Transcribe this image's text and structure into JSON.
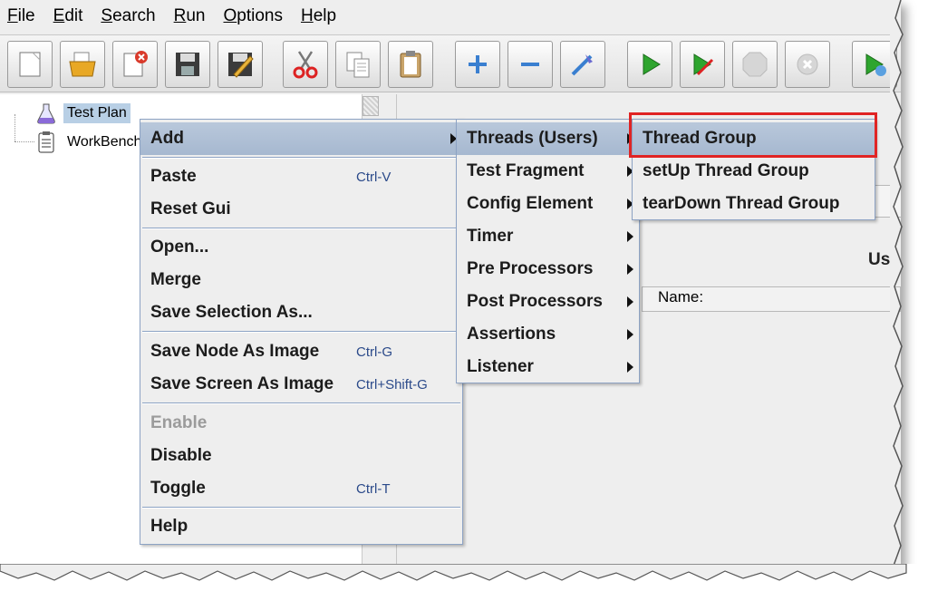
{
  "menubar": [
    "File",
    "Edit",
    "Search",
    "Run",
    "Options",
    "Help"
  ],
  "toolbar": {
    "buttons": [
      {
        "name": "new-icon"
      },
      {
        "name": "open-icon"
      },
      {
        "name": "close-file-icon"
      },
      {
        "name": "save-icon"
      },
      {
        "name": "save-as-icon"
      },
      {
        "name": "cut-icon"
      },
      {
        "name": "copy-icon"
      },
      {
        "name": "paste-icon"
      },
      {
        "name": "expand-icon"
      },
      {
        "name": "collapse-icon"
      },
      {
        "name": "toggle-icon"
      },
      {
        "name": "start-icon"
      },
      {
        "name": "start-no-pauses-icon"
      },
      {
        "name": "stop-icon"
      },
      {
        "name": "shutdown-icon"
      },
      {
        "name": "remote-start-icon"
      }
    ]
  },
  "tree": {
    "nodes": [
      {
        "label": "Test Plan",
        "selected": true
      },
      {
        "label": "WorkBench",
        "selected": false
      }
    ]
  },
  "right_panel": {
    "name_label": "Name:",
    "partial_label": "Us"
  },
  "context_menu": {
    "items": [
      {
        "label": "Add",
        "shortcut": "",
        "submenu": true,
        "highlighted": true
      },
      {
        "label": "Paste",
        "shortcut": "Ctrl-V"
      },
      {
        "label": "Reset Gui",
        "shortcut": ""
      },
      {
        "label": "Open...",
        "shortcut": ""
      },
      {
        "label": "Merge",
        "shortcut": ""
      },
      {
        "label": "Save Selection As...",
        "shortcut": ""
      },
      {
        "label": "Save Node As Image",
        "shortcut": "Ctrl-G"
      },
      {
        "label": "Save Screen As Image",
        "shortcut": "Ctrl+Shift-G"
      },
      {
        "label": "Enable",
        "shortcut": "",
        "disabled": true
      },
      {
        "label": "Disable",
        "shortcut": ""
      },
      {
        "label": "Toggle",
        "shortcut": "Ctrl-T"
      },
      {
        "label": "Help",
        "shortcut": ""
      }
    ]
  },
  "add_submenu": {
    "items": [
      {
        "label": "Threads (Users)",
        "highlighted": true
      },
      {
        "label": "Test Fragment"
      },
      {
        "label": "Config Element"
      },
      {
        "label": "Timer"
      },
      {
        "label": "Pre Processors"
      },
      {
        "label": "Post Processors"
      },
      {
        "label": "Assertions"
      },
      {
        "label": "Listener"
      }
    ]
  },
  "threads_submenu": {
    "items": [
      {
        "label": "Thread Group",
        "highlighted": true
      },
      {
        "label": "setUp Thread Group"
      },
      {
        "label": "tearDown Thread Group"
      }
    ]
  },
  "colors": {
    "highlight": "#a6b8d0",
    "annotation_box": "#e02424",
    "menu_border": "#8da3c4"
  }
}
